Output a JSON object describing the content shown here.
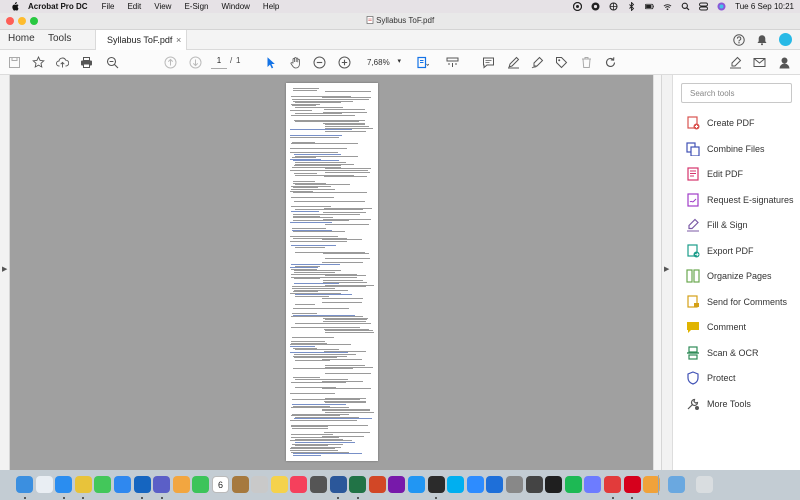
{
  "menubar": {
    "app_name": "Acrobat Pro DC",
    "items": [
      "File",
      "Edit",
      "View",
      "E-Sign",
      "Window",
      "Help"
    ],
    "clock": "Tue 6 Sep  10:21"
  },
  "window": {
    "title": "Syllabus ToF.pdf"
  },
  "tabs": {
    "home": "Home",
    "tools": "Tools",
    "document": "Syllabus ToF.pdf",
    "close_symbol": "×"
  },
  "toolbar": {
    "current_page": "1",
    "page_separator": "/",
    "total_pages": "1",
    "zoom": "7,68%"
  },
  "tools_pane": {
    "search_placeholder": "Search tools",
    "items": [
      {
        "label": "Create PDF",
        "icon": "create-pdf-icon",
        "color": "#d9534f"
      },
      {
        "label": "Combine Files",
        "icon": "combine-files-icon",
        "color": "#3f51b5"
      },
      {
        "label": "Edit PDF",
        "icon": "edit-pdf-icon",
        "color": "#d6336c"
      },
      {
        "label": "Request E-signatures",
        "icon": "request-esignatures-icon",
        "color": "#a03cc8"
      },
      {
        "label": "Fill & Sign",
        "icon": "fill-sign-icon",
        "color": "#7b5aa6"
      },
      {
        "label": "Export PDF",
        "icon": "export-pdf-icon",
        "color": "#1a9c8a"
      },
      {
        "label": "Organize Pages",
        "icon": "organize-pages-icon",
        "color": "#6aa84f"
      },
      {
        "label": "Send for Comments",
        "icon": "send-comments-icon",
        "color": "#d4a017"
      },
      {
        "label": "Comment",
        "icon": "comment-icon",
        "color": "#e0b400"
      },
      {
        "label": "Scan & OCR",
        "icon": "scan-ocr-icon",
        "color": "#2e8b57"
      },
      {
        "label": "Protect",
        "icon": "protect-icon",
        "color": "#3f51b5"
      },
      {
        "label": "More Tools",
        "icon": "more-tools-icon",
        "color": "#555555"
      }
    ]
  },
  "dock": {
    "calendar_day": "6"
  },
  "colors": {
    "accent": "#1473e6",
    "viewer_bg": "#a0a0a0",
    "menubar_bg": "#e6e2e6",
    "dock_bg": "#c3ccd3"
  }
}
